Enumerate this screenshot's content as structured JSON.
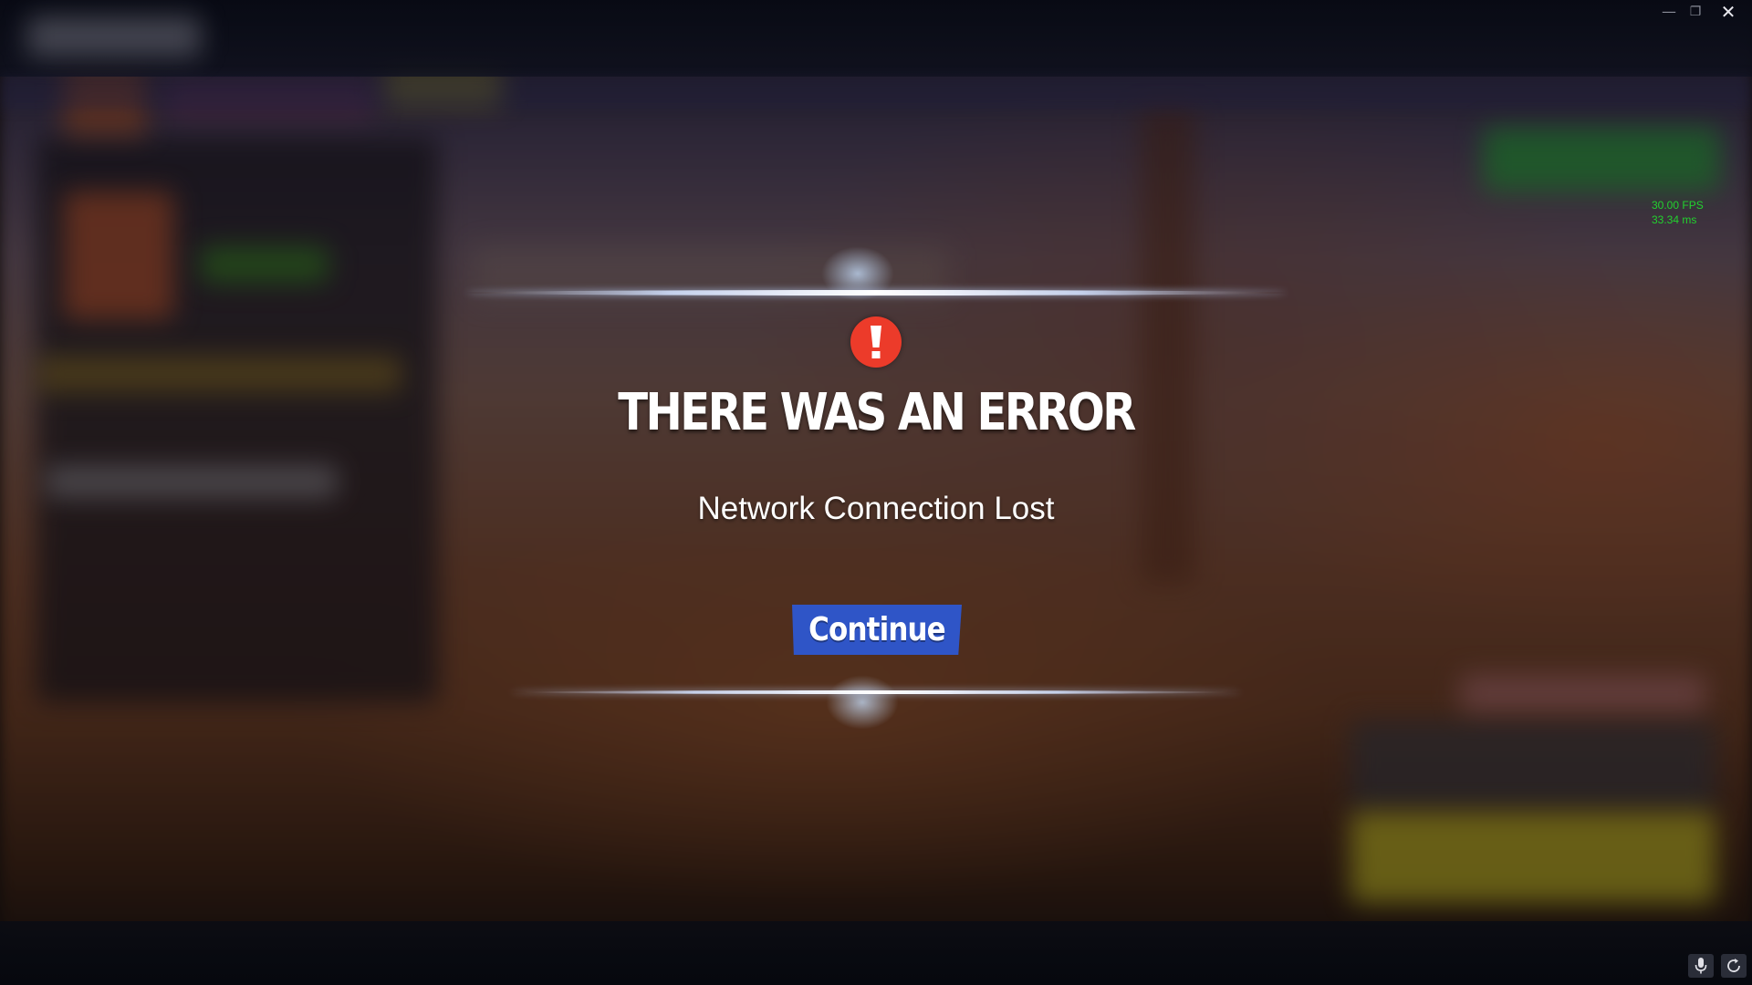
{
  "dialog": {
    "title": "THERE WAS AN ERROR",
    "message": "Network Connection Lost",
    "continue_label": "Continue",
    "icon": "exclamation-icon",
    "icon_color": "#ec3b2a",
    "button_color": "#2f55c7"
  },
  "overlay": {
    "fps": "30.00 FPS",
    "frame_time": "33.34 ms",
    "fps_color": "#22d12e"
  },
  "window": {
    "controls": [
      "minimize-icon",
      "maximize-icon",
      "close-icon"
    ],
    "close_glyph": "✕",
    "min_glyph": "—",
    "max_glyph": "❐"
  },
  "footer": {
    "icons": [
      "microphone-icon",
      "refresh-icon"
    ]
  }
}
